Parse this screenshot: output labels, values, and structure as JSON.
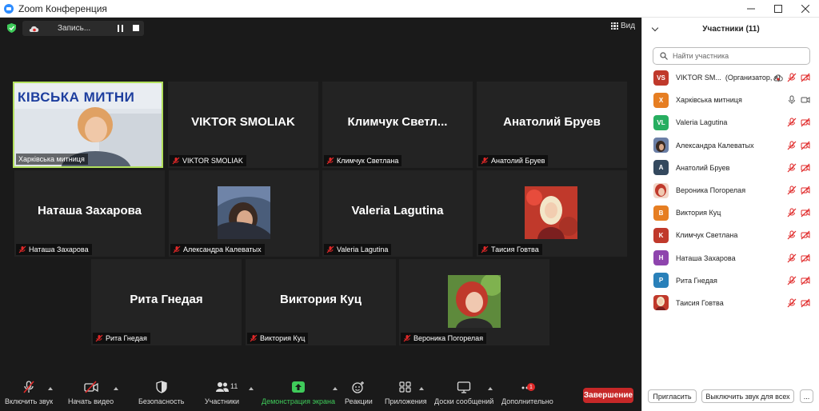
{
  "window": {
    "title": "Zoom Конференция"
  },
  "topbar": {
    "recording_label": "Запись...",
    "view_label": "Вид"
  },
  "tiles": [
    {
      "name": "Харківська митниця",
      "big_name": "",
      "video": true,
      "banner": "КІВСЬКА МИТНИ"
    },
    {
      "name": "VIKTOR SMOLIAK",
      "big_name": "VIKTOR SMOLIAK"
    },
    {
      "name": "Климчук Светлана",
      "big_name": "Климчук  Светл..."
    },
    {
      "name": "Анатолий Бруев",
      "big_name": "Анатолий Бруев"
    },
    {
      "name": "Наташа Захарова",
      "big_name": "Наташа Захарова"
    },
    {
      "name": "Александра Калеватых",
      "big_name": "",
      "photo": true
    },
    {
      "name": "Valeria Lagutina",
      "big_name": "Valeria Lagutina"
    },
    {
      "name": "Таисия Говтва",
      "big_name": "",
      "photo": true
    },
    {
      "name": "Рита Гнедая",
      "big_name": "Рита Гнедая"
    },
    {
      "name": "Виктория Куц",
      "big_name": "Виктория Куц"
    },
    {
      "name": "Вероника Погорелая",
      "big_name": "",
      "photo": true
    }
  ],
  "toolbar": {
    "unmute": "Включить звук",
    "start_video": "Начать видео",
    "security": "Безопасность",
    "participants": "Участники",
    "participants_count": "11",
    "share": "Демонстрация экрана",
    "reactions": "Реакции",
    "apps": "Приложения",
    "whiteboards": "Доски сообщений",
    "more": "Дополнительно",
    "more_badge": "1",
    "end": "Завершение"
  },
  "panel": {
    "title": "Участники (11)",
    "search_placeholder": "Найти участника",
    "participants": [
      {
        "initials": "VS",
        "name": "VIKTOR SM...",
        "role": "(Организатор, я)",
        "color": "#c0392b",
        "state": "host"
      },
      {
        "initials": "Х",
        "name": "Харківська митниця",
        "color": "#e67e22",
        "state": "active"
      },
      {
        "initials": "VL",
        "name": "Valeria Lagutina",
        "color": "#27ae60"
      },
      {
        "initials": "",
        "name": "Александра Калеватых",
        "color": "#6b7fa6",
        "photo": true
      },
      {
        "initials": "A",
        "name": "Анатолий Бруев",
        "color": "#34495e"
      },
      {
        "initials": "",
        "name": "Вероника Погорелая",
        "color": "#d9a08b",
        "photo": true
      },
      {
        "initials": "B",
        "name": "Виктория Куц",
        "color": "#e67e22"
      },
      {
        "initials": "K",
        "name": "Климчук Светлана",
        "color": "#c0392b"
      },
      {
        "initials": "H",
        "name": "Наташа Захарова",
        "color": "#8e44ad"
      },
      {
        "initials": "P",
        "name": "Рита Гнедая",
        "color": "#2980b9"
      },
      {
        "initials": "",
        "name": "Таисия Говтва",
        "color": "#b55a5a",
        "photo": true
      }
    ],
    "invite": "Пригласить",
    "mute_all": "Выключить звук для всех",
    "more": "..."
  },
  "colors": {
    "stage": "#1a1a1a",
    "tile": "#232323",
    "active_border": "#b2e05d",
    "end_button": "#c62828",
    "share_green": "#3fcb5a",
    "mute_red": "#e02828"
  }
}
